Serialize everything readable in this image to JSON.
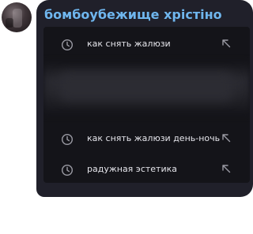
{
  "message": {
    "sender_name": "бомбоубежище хрістіно"
  },
  "search_history": [
    {
      "text": "как снять жалюзи",
      "icon": "clock-icon",
      "action_icon": "arrow-up-left-icon"
    },
    {
      "text": "как снять жалюзи день-ночь",
      "icon": "clock-icon",
      "action_icon": "arrow-up-left-icon"
    },
    {
      "text": "радужная эстетика",
      "icon": "clock-icon",
      "action_icon": "arrow-up-left-icon"
    }
  ],
  "colors": {
    "bubble": "#20202a",
    "sender": "#6fb6ee",
    "screenshot_bg": "#141419",
    "text": "#e6e6ec",
    "icon": "#9a9aa3"
  }
}
